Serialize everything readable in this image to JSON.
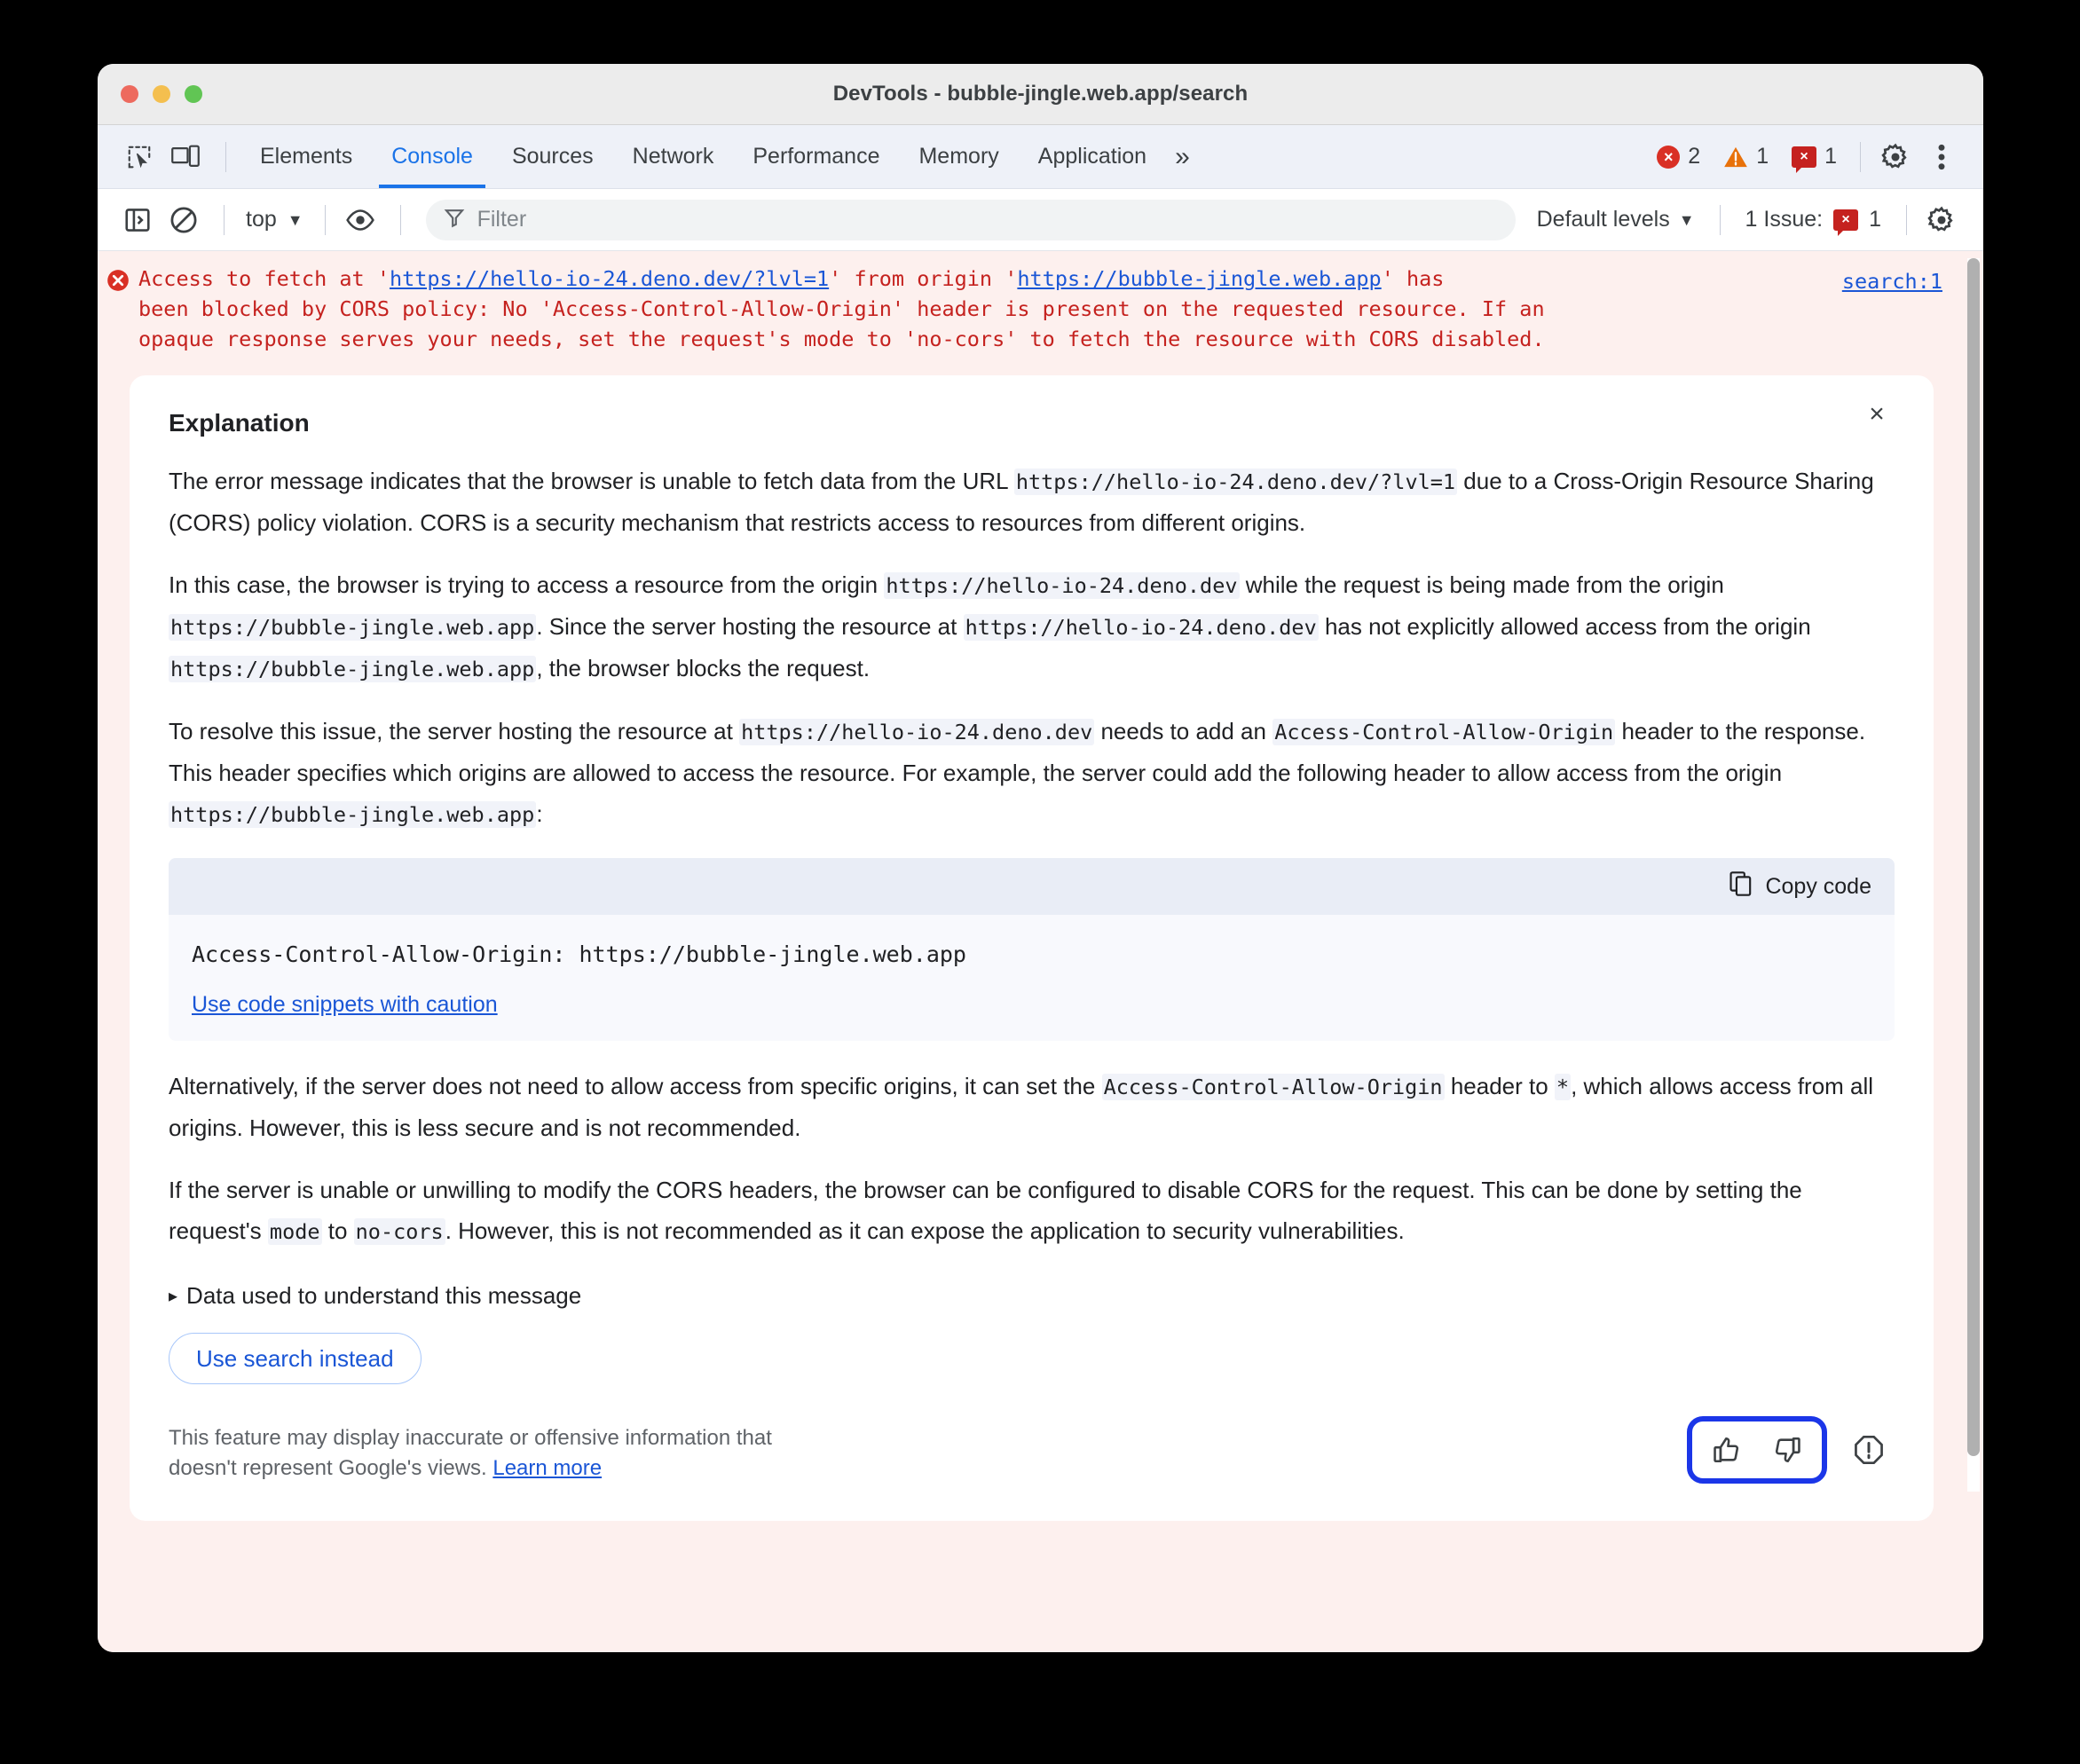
{
  "window": {
    "title": "DevTools - bubble-jingle.web.app/search",
    "traffic_lights": [
      "close",
      "minimize",
      "zoom"
    ]
  },
  "tabstrip": {
    "inspect_icon": "inspect-element-icon",
    "device_icon": "device-toolbar-icon",
    "tabs": [
      {
        "label": "Elements",
        "active": false
      },
      {
        "label": "Console",
        "active": true
      },
      {
        "label": "Sources",
        "active": false
      },
      {
        "label": "Network",
        "active": false
      },
      {
        "label": "Performance",
        "active": false
      },
      {
        "label": "Memory",
        "active": false
      },
      {
        "label": "Application",
        "active": false
      }
    ],
    "overflow_label": "»",
    "counters": {
      "errors": "2",
      "warnings": "1",
      "issues": "1",
      "issue_badge_glyph": "×",
      "error_glyph": "×"
    },
    "settings_icon": "gear-icon",
    "more_icon": "more-vertical-icon"
  },
  "console_toolbar": {
    "sidebar_icon": "console-sidebar-icon",
    "clear_icon": "clear-console-icon",
    "context_value": "top",
    "context_caret": "▼",
    "eye_icon": "live-expression-icon",
    "filter_icon": "filter-icon",
    "filter_placeholder": "Filter",
    "filter_value": "",
    "levels_label": "Default levels",
    "levels_caret": "▼",
    "issues_label": "1 Issue:",
    "issues_count": "1",
    "settings_icon": "gear-icon"
  },
  "console_message": {
    "icon": "error-icon",
    "prefix": "Access to fetch at '",
    "url_1": "https://hello-io-24.deno.dev/?lvl=1",
    "mid_1": "' from origin '",
    "url_2": "https://bubble-jingle.web.app",
    "tail": "' has\nbeen blocked by CORS policy: No 'Access-Control-Allow-Origin' header is present on the requested resource. If an\nopaque response serves your needs, set the request's mode to 'no-cors' to fetch the resource with CORS disabled.",
    "source_link": "search:1"
  },
  "explanation": {
    "title": "Explanation",
    "close_label": "×",
    "paragraph_1": {
      "part_1": "The error message indicates that the browser is unable to fetch data from the URL ",
      "code_1": "https://hello-io-24.deno.dev/?lvl=1",
      "part_2": " due to a Cross-Origin Resource Sharing (CORS) policy violation. CORS is a security mechanism that restricts access to resources from different origins."
    },
    "paragraph_2": {
      "part_1": "In this case, the browser is trying to access a resource from the origin ",
      "code_1": "https://hello-io-24.deno.dev",
      "part_2": " while the request is being made from the origin ",
      "code_2": "https://bubble-jingle.web.app",
      "part_3": ". Since the server hosting the resource at ",
      "code_3": "https://hello-io-24.deno.dev",
      "part_4": " has not explicitly allowed access from the origin ",
      "code_4": "https://bubble-jingle.web.app",
      "part_5": ", the browser blocks the request."
    },
    "paragraph_3": {
      "part_1": "To resolve this issue, the server hosting the resource at ",
      "code_1": "https://hello-io-24.deno.dev",
      "part_2": " needs to add an ",
      "code_2": "Access-Control-Allow-Origin",
      "part_3": " header to the response. This header specifies which origins are allowed to access the resource. For example, the server could add the following header to allow access from the origin ",
      "code_3": "https://bubble-jingle.web.app",
      "part_4": ":"
    },
    "code_block": {
      "copy_icon": "copy-icon",
      "copy_label": "Copy code",
      "code": "Access-Control-Allow-Origin: https://bubble-jingle.web.app",
      "caution_link": "Use code snippets with caution"
    },
    "paragraph_4": {
      "part_1": "Alternatively, if the server does not need to allow access from specific origins, it can set the ",
      "code_1": "Access-Control-Allow-Origin",
      "part_2": " header to ",
      "code_2": "*",
      "part_3": ", which allows access from all origins. However, this is less secure and is not recommended."
    },
    "paragraph_5": {
      "part_1": "If the server is unable or unwilling to modify the CORS headers, the browser can be configured to disable CORS for the request. This can be done by setting the request's ",
      "code_1": "mode",
      "part_2": " to ",
      "code_2": "no-cors",
      "part_3": ". However, this is not recommended as it can expose the application to security vulnerabilities."
    },
    "disclosure": {
      "triangle": "▸",
      "label": "Data used to understand this message"
    },
    "search_button": "Use search instead",
    "footer": {
      "disclaimer_1": "This feature may display inaccurate or offensive information that",
      "disclaimer_2": "doesn't represent Google's views. ",
      "learn_more": "Learn more",
      "thumbs_up_icon": "thumb-up-icon",
      "thumbs_down_icon": "thumb-down-icon",
      "report_icon": "report-warning-icon"
    }
  },
  "colors": {
    "accent": "#1a73e8",
    "error": "#d93025",
    "error_bg": "#fdf0ee",
    "link": "#1a56d6",
    "focus_ring": "#1b36e8",
    "warning": "#e8710a"
  }
}
